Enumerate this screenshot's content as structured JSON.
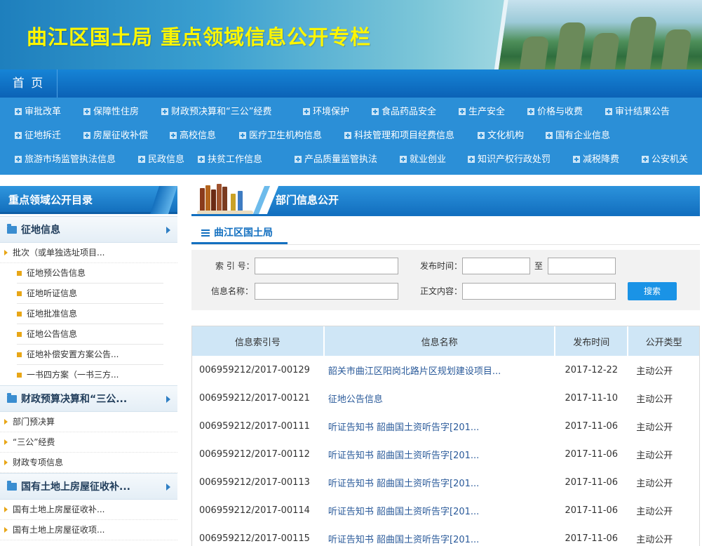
{
  "banner": {
    "title": "曲江区国土局 重点领域信息公开专栏"
  },
  "nav": {
    "home": "首 页"
  },
  "categories": {
    "rows": [
      [
        "审批改革",
        "保障性住房",
        "财政预决算和“三公”经费",
        "环境保护",
        "食品药品安全",
        "生产安全",
        "价格与收费",
        "审计结果公告"
      ],
      [
        "征地拆迁",
        "房屋征收补偿",
        "高校信息",
        "医疗卫生机构信息",
        "科技管理和项目经费信息",
        "文化机构",
        "国有企业信息"
      ],
      [
        "旅游市场监管执法信息",
        "民政信息",
        "扶贫工作信息",
        "产品质量监管执法",
        "就业创业",
        "知识产权行政处罚",
        "减税降费",
        "公安机关"
      ]
    ]
  },
  "sidebar": {
    "title": "重点领域公开目录",
    "sections": [
      {
        "label": "征地信息",
        "subs": [
          {
            "label": "批次（或单独选址项目...",
            "leaves": [
              "征地预公告信息",
              "征地听证信息",
              "征地批准信息",
              "征地公告信息",
              "征地补偿安置方案公告...",
              "一书四方案（一书三方..."
            ]
          }
        ]
      },
      {
        "label": "财政预算决算和“三公...",
        "subs": [
          {
            "label": "部门预决算",
            "leaves": []
          },
          {
            "label": "“三公”经费",
            "leaves": []
          },
          {
            "label": "财政专项信息",
            "leaves": []
          }
        ]
      },
      {
        "label": "国有土地上房屋征收补...",
        "subs": [
          {
            "label": "国有土地上房屋征收补...",
            "leaves": []
          },
          {
            "label": "国有土地上房屋征收项...",
            "leaves": []
          }
        ]
      }
    ]
  },
  "main": {
    "header": "部门信息公开",
    "tab": "曲江区国土局",
    "search": {
      "index_label": "索 引 号：",
      "date_label": "发布时间：",
      "to_label": "至",
      "name_label": "信息名称：",
      "content_label": "正文内容：",
      "button": "搜索",
      "index_value": "",
      "date_from": "",
      "date_to": "",
      "name_value": "",
      "content_value": ""
    },
    "table": {
      "headers": [
        "信息索引号",
        "信息名称",
        "发布时间",
        "公开类型"
      ],
      "rows": [
        [
          "006959212/2017-00129",
          "韶关市曲江区阳岗北路片区规划建设项目...",
          "2017-12-22",
          "主动公开"
        ],
        [
          "006959212/2017-00121",
          "征地公告信息",
          "2017-11-10",
          "主动公开"
        ],
        [
          "006959212/2017-00111",
          "听证告知书 韶曲国土资听告字[201...",
          "2017-11-06",
          "主动公开"
        ],
        [
          "006959212/2017-00112",
          "听证告知书 韶曲国土资听告字[201...",
          "2017-11-06",
          "主动公开"
        ],
        [
          "006959212/2017-00113",
          "听证告知书 韶曲国土资听告字[201...",
          "2017-11-06",
          "主动公开"
        ],
        [
          "006959212/2017-00114",
          "听证告知书 韶曲国土资听告字[201...",
          "2017-11-06",
          "主动公开"
        ],
        [
          "006959212/2017-00115",
          "听证告知书 韶曲国土资听告字[201...",
          "2017-11-06",
          "主动公开"
        ]
      ]
    }
  }
}
